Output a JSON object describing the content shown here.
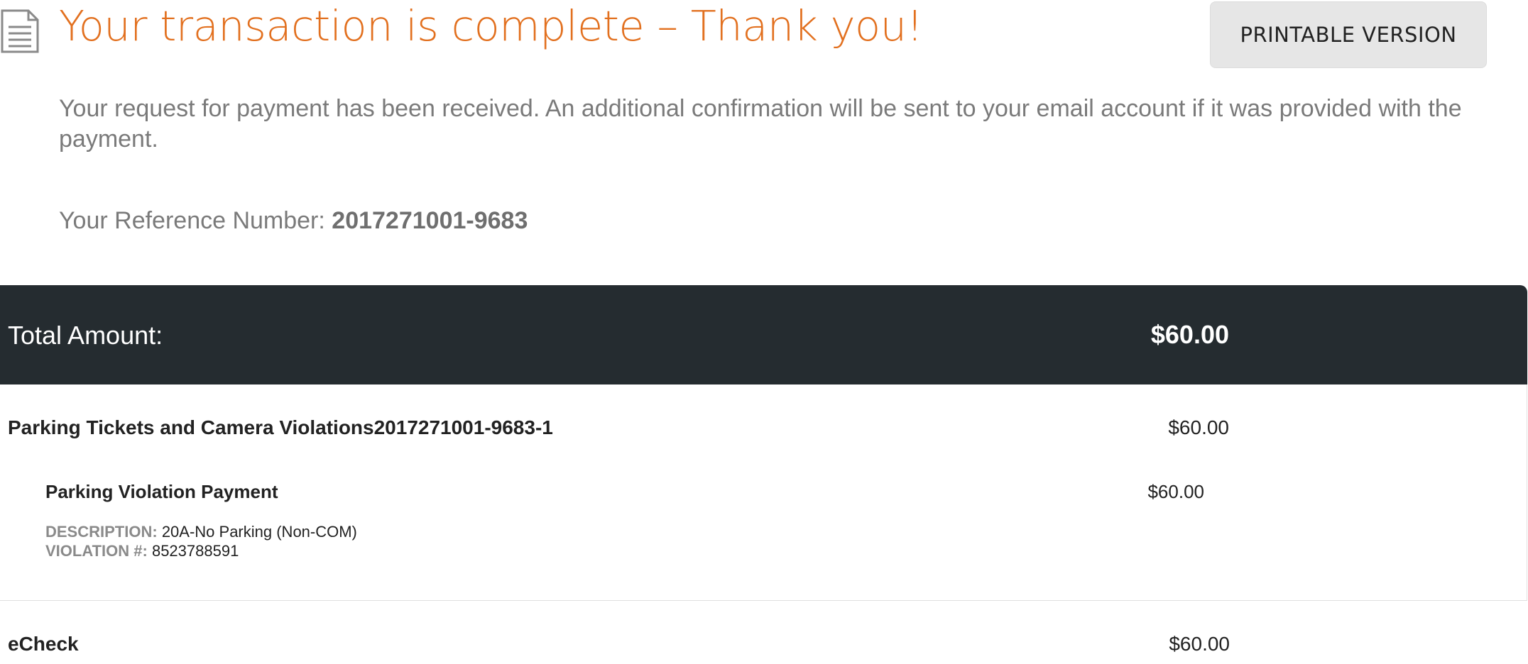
{
  "header": {
    "icon": "document-icon",
    "title": "Your transaction is complete – Thank you!",
    "print_label": "PRINTABLE VERSION"
  },
  "intro": "Your request for payment has been received. An additional confirmation will be sent to your email account if it was provided with the payment.",
  "reference": {
    "label": "Your Reference Number:",
    "number": "2017271001-9683"
  },
  "summary": {
    "total_label": "Total Amount:",
    "total_value": "$60.00"
  },
  "line_item": {
    "title": "Parking Tickets and Camera Violations2017271001-9683-1",
    "amount": "$60.00",
    "sub_title": "Parking Violation Payment",
    "sub_amount": "$60.00",
    "description_label": "DESCRIPTION:",
    "description_value": "20A-No Parking (Non-COM)",
    "violation_label": "VIOLATION #:",
    "violation_value": "8523788591"
  },
  "payment": {
    "method": "eCheck",
    "amount": "$60.00"
  },
  "colors": {
    "title_orange": "#e2701f",
    "total_bar": "#252c30",
    "muted_text": "#7a7a7a",
    "button_bg": "#e6e6e6"
  }
}
